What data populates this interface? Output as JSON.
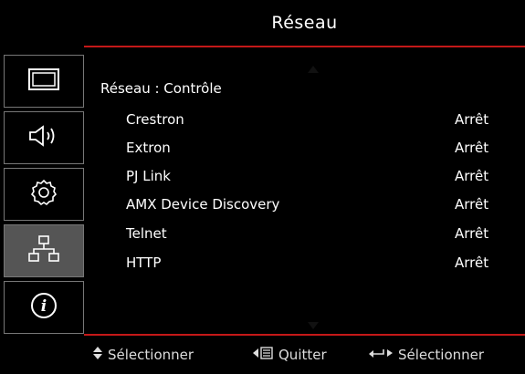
{
  "header": {
    "title": "Réseau"
  },
  "sidebar": {
    "items": [
      {
        "icon": "display-icon",
        "active": false
      },
      {
        "icon": "speaker-icon",
        "active": false
      },
      {
        "icon": "gear-icon",
        "active": false
      },
      {
        "icon": "network-icon",
        "active": true
      },
      {
        "icon": "info-icon",
        "active": false
      }
    ]
  },
  "main": {
    "heading": "Réseau : Contrôle",
    "rows": [
      {
        "label": "Crestron",
        "value": "Arrêt"
      },
      {
        "label": "Extron",
        "value": "Arrêt"
      },
      {
        "label": "PJ Link",
        "value": "Arrêt"
      },
      {
        "label": "AMX Device Discovery",
        "value": "Arrêt"
      },
      {
        "label": "Telnet",
        "value": "Arrêt"
      },
      {
        "label": "HTTP",
        "value": "Arrêt"
      }
    ]
  },
  "footer": {
    "select_label": "Sélectionner",
    "quit_label": "Quitter",
    "enter_label": "Sélectionner"
  },
  "colors": {
    "accent": "#c41818",
    "active_bg": "#555555"
  }
}
